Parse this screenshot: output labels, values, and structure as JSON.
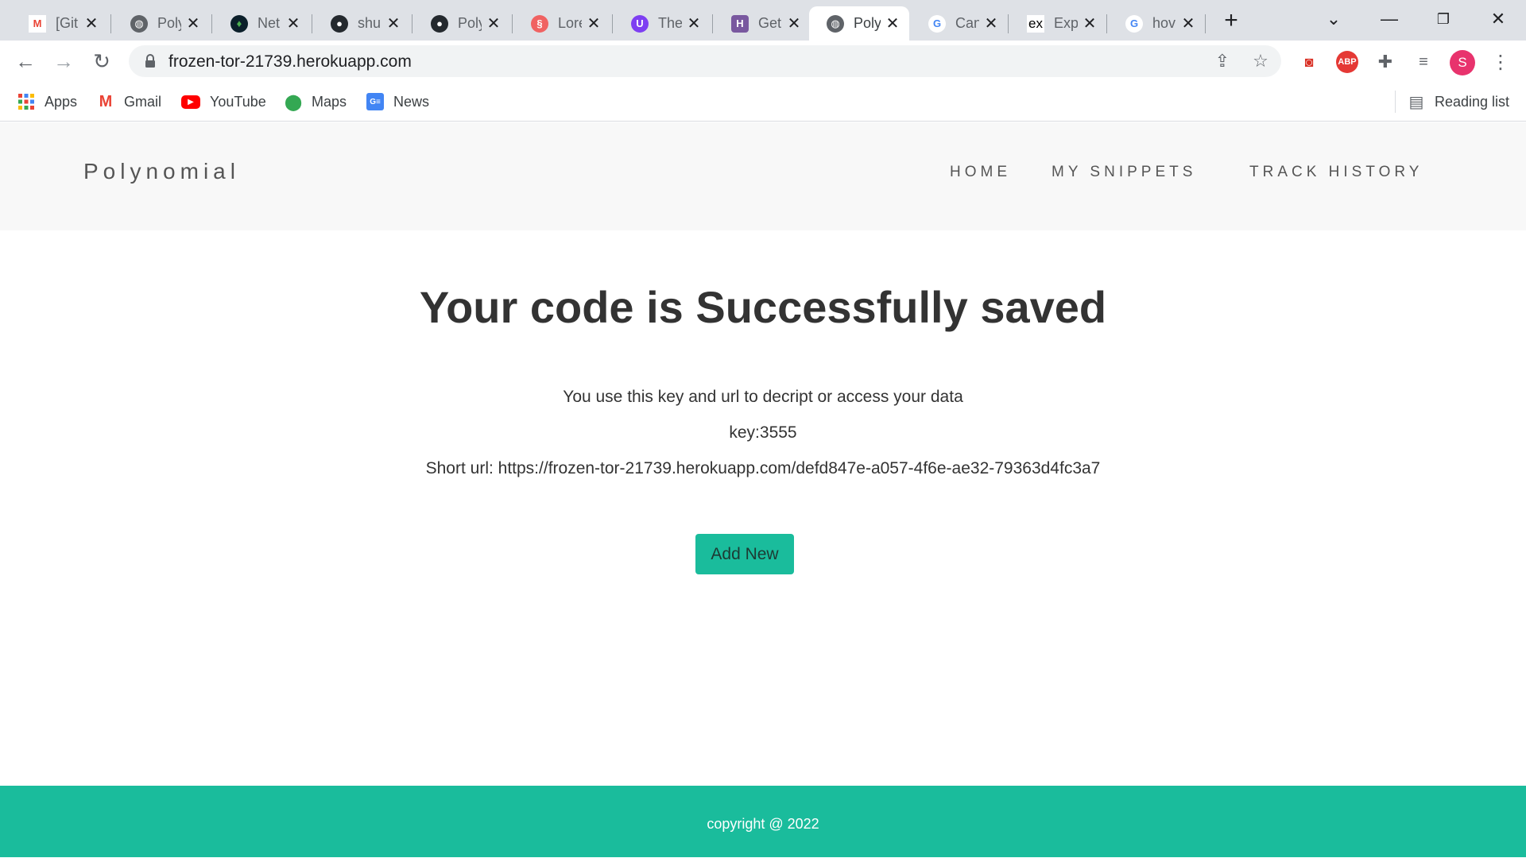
{
  "browser": {
    "tabs": [
      {
        "title": "[Git",
        "icon": "gmail-icon",
        "active": false
      },
      {
        "title": "Poly",
        "icon": "globe-icon",
        "active": false
      },
      {
        "title": "Net",
        "icon": "leaf-icon",
        "active": false
      },
      {
        "title": "shu",
        "icon": "github-icon",
        "active": false
      },
      {
        "title": "Poly",
        "icon": "github-icon",
        "active": false
      },
      {
        "title": "Lore",
        "icon": "lorem-icon",
        "active": false
      },
      {
        "title": "The",
        "icon": "u-icon",
        "active": false
      },
      {
        "title": "Get",
        "icon": "heroku-icon",
        "active": false
      },
      {
        "title": "Poly",
        "icon": "globe-icon",
        "active": true
      },
      {
        "title": "Can",
        "icon": "google-icon",
        "active": false
      },
      {
        "title": "Exp",
        "icon": "ex-icon",
        "active": false
      },
      {
        "title": "hov",
        "icon": "google-icon",
        "active": false
      }
    ],
    "url": "frozen-tor-21739.herokuapp.com",
    "profile_initial": "S",
    "ext_abp": "ABP",
    "bookmarks": [
      {
        "label": "Apps",
        "icon": "apps-grid-icon"
      },
      {
        "label": "Gmail",
        "icon": "gmail-icon"
      },
      {
        "label": "YouTube",
        "icon": "youtube-icon"
      },
      {
        "label": "Maps",
        "icon": "maps-pin-icon"
      },
      {
        "label": "News",
        "icon": "news-icon"
      }
    ],
    "reading_list": "Reading list"
  },
  "site": {
    "brand": "Polynomial",
    "nav": [
      "HOME",
      "MY SNIPPETS",
      "TRACK HISTORY"
    ]
  },
  "main": {
    "headline": "Your code is Successfully saved",
    "instruction": "You use this key and url to decript or access your data",
    "key_line": "key:3555",
    "short_url_line": "Short url: https://frozen-tor-21739.herokuapp.com/defd847e-a057-4f6e-ae32-79363d4fc3a7",
    "add_button": "Add New"
  },
  "footer": {
    "copyright": "copyright @ 2022"
  },
  "colors": {
    "accent": "#1abc9c",
    "header_bg": "#f8f8f8",
    "tabstrip_bg": "#dee1e6"
  }
}
